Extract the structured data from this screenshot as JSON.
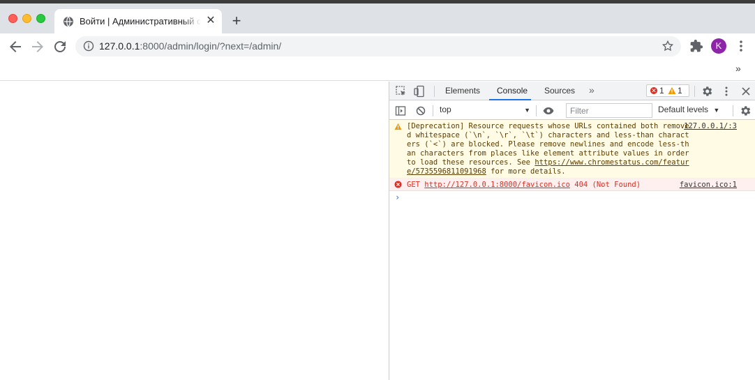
{
  "browser": {
    "tab": {
      "title": "Войти | Административный сайт Django"
    },
    "address_bar": {
      "host": "127.0.0.1",
      "rest": ":8000/admin/login/?next=/admin/"
    },
    "avatar_letter": "K",
    "colors": {
      "tab_strip": "#dee1e6",
      "avatar": "#8e24aa",
      "accent": "#1a73e8"
    }
  },
  "devtools": {
    "tabs": [
      {
        "label": "Elements"
      },
      {
        "label": "Console"
      },
      {
        "label": "Sources"
      }
    ],
    "active_tab": "Console",
    "issues": {
      "errors": "1",
      "warnings": "1"
    },
    "console_toolbar": {
      "context": "top",
      "filter_placeholder": "Filter",
      "levels": "Default levels"
    },
    "messages": {
      "warning": {
        "text_1": "[Deprecation] Resource requests whose URLs contained both removed whitespace (`\\n`, `\\r`, `\\t`) characters and less-than characters (`<`) are blocked. Please remove newlines and encode less-than characters from places like element attribute values in order to load these resources. See ",
        "link": "https://www.chromestatus.com/feature/5735596811091968",
        "text_2": " for more details.",
        "source": "127.0.0.1/:3"
      },
      "error": {
        "method": "GET",
        "url": "http://127.0.0.1:8000/favicon.ico",
        "status": "404 (Not Found)",
        "source": "favicon.ico:1"
      }
    },
    "prompt": "›"
  }
}
